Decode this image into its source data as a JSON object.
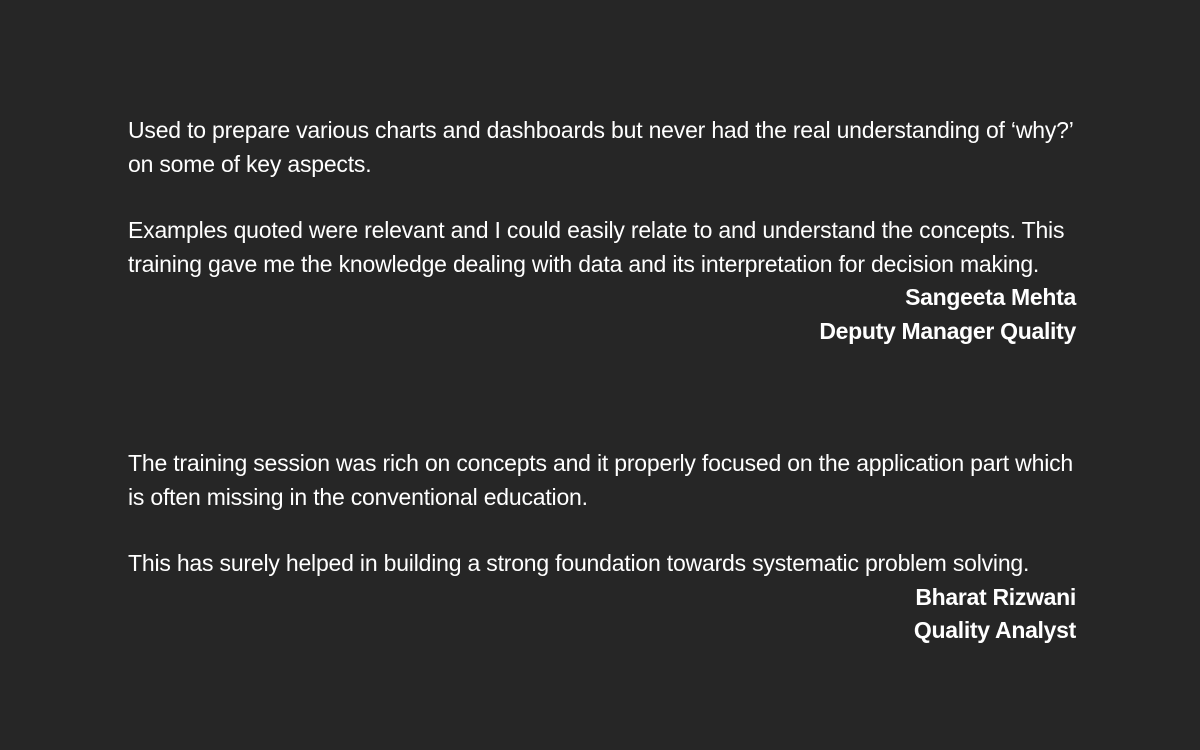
{
  "testimonials": [
    {
      "paragraphs": [
        "Used to prepare various charts and dashboards but never had the real understanding of ‘why?’ on some of key aspects.",
        "Examples quoted were relevant and I could easily relate to and understand the concepts. This training gave me the knowledge dealing with data and its interpretation for decision making."
      ],
      "name": "Sangeeta Mehta",
      "role": "Deputy Manager Quality"
    },
    {
      "paragraphs": [
        "The training session was rich on concepts and it properly focused on the application part which is often missing in the conventional education.",
        "This has surely helped in building a strong foundation towards systematic problem solving."
      ],
      "name": "Bharat Rizwani",
      "role": "Quality Analyst"
    }
  ]
}
